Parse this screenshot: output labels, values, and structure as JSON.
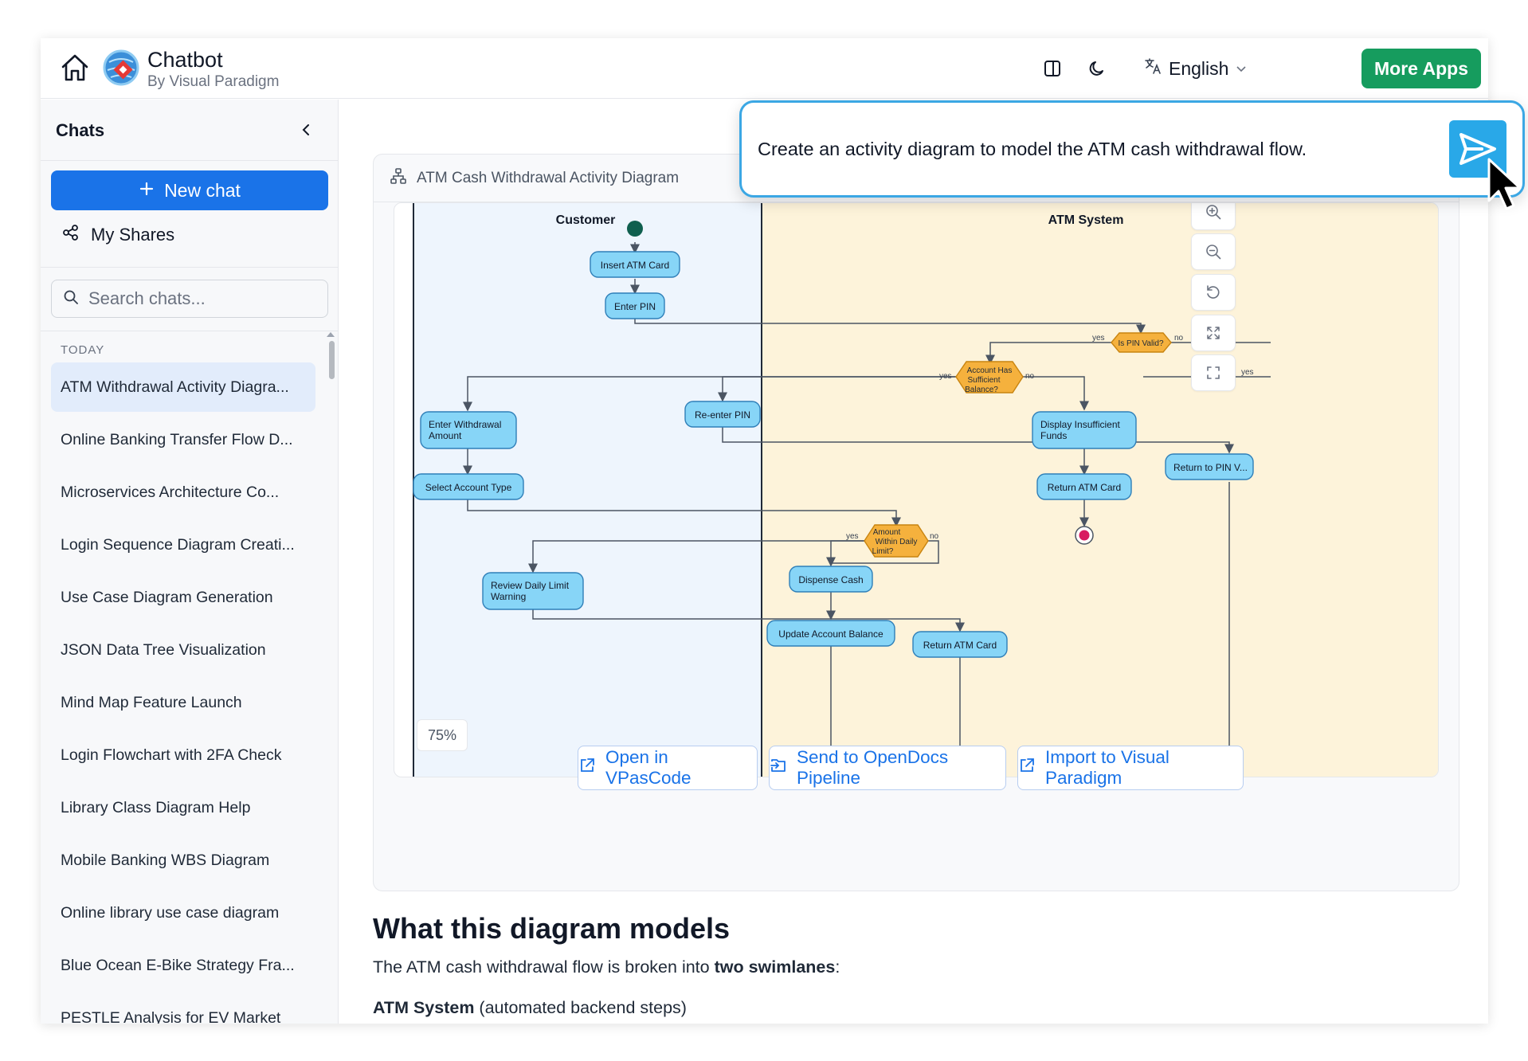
{
  "header": {
    "brand_name": "Chatbot",
    "brand_sub": "By Visual Paradigm",
    "language": "English",
    "more_apps": "More Apps"
  },
  "sidebar": {
    "title": "Chats",
    "new_chat": "New chat",
    "my_shares": "My Shares",
    "search_placeholder": "Search chats...",
    "section": "TODAY",
    "chats": [
      "ATM Withdrawal Activity Diagra...",
      "Online Banking Transfer Flow D...",
      "Microservices Architecture Co...",
      "Login Sequence Diagram Creati...",
      "Use Case Diagram Generation",
      "JSON Data Tree Visualization",
      "Mind Map Feature Launch",
      "Login Flowchart with 2FA Check",
      "Library Class Diagram Help",
      "Mobile Banking WBS Diagram",
      "Online library use case diagram",
      "Blue Ocean E-Bike Strategy Fra...",
      "PESTLE Analysis for EV Market"
    ]
  },
  "prompt": {
    "text": "Create an activity diagram to model the ATM cash withdrawal flow."
  },
  "diagram": {
    "title": "ATM Cash Withdrawal Activity Diagram",
    "zoom": "75%",
    "lanes": [
      "Customer",
      "ATM System"
    ],
    "nodes": {
      "insert_card": "Insert ATM Card",
      "enter_pin": "Enter PIN",
      "is_pin_valid": "Is PIN Valid?",
      "account_has_1": "Account Has",
      "account_has_2": "Sufficient",
      "account_has_3": "Balance?",
      "reenter_pin": "Re-enter PIN",
      "enter_amount_1": "Enter Withdrawal",
      "enter_amount_2": "Amount",
      "display_insufficient_1": "Display Insufficient",
      "display_insufficient_2": "Funds",
      "return_pin": "Return to PIN V...",
      "select_account": "Select Account Type",
      "return_card_1": "Return ATM Card",
      "amount_within_1": "Amount",
      "amount_within_2": "Within Daily",
      "amount_within_3": "Limit?",
      "review_warning_1": "Review Daily Limit",
      "review_warning_2": "Warning",
      "dispense": "Dispense Cash",
      "update_balance": "Update Account Balance",
      "return_card_2": "Return ATM Card"
    },
    "guards": {
      "yes": "yes",
      "no": "no"
    }
  },
  "actions": {
    "open_vpascode": "Open in VPasCode",
    "send_opendocs": "Send to OpenDocs Pipeline",
    "import_vp": "Import to Visual Paradigm"
  },
  "content": {
    "heading": "What this diagram models",
    "intro_before": "The ATM cash withdrawal flow is broken into ",
    "intro_bold": "two swimlanes",
    "intro_after": ":",
    "lane_bold": "ATM System",
    "lane_desc": " (automated backend steps)"
  },
  "colors": {
    "primary": "#1a73e8",
    "more_apps": "#169c5e",
    "node_fill": "#87d5f7",
    "decision_fill": "#f5b13d",
    "customer_lane": "#eef5fd",
    "atm_lane": "#fdf3da"
  }
}
